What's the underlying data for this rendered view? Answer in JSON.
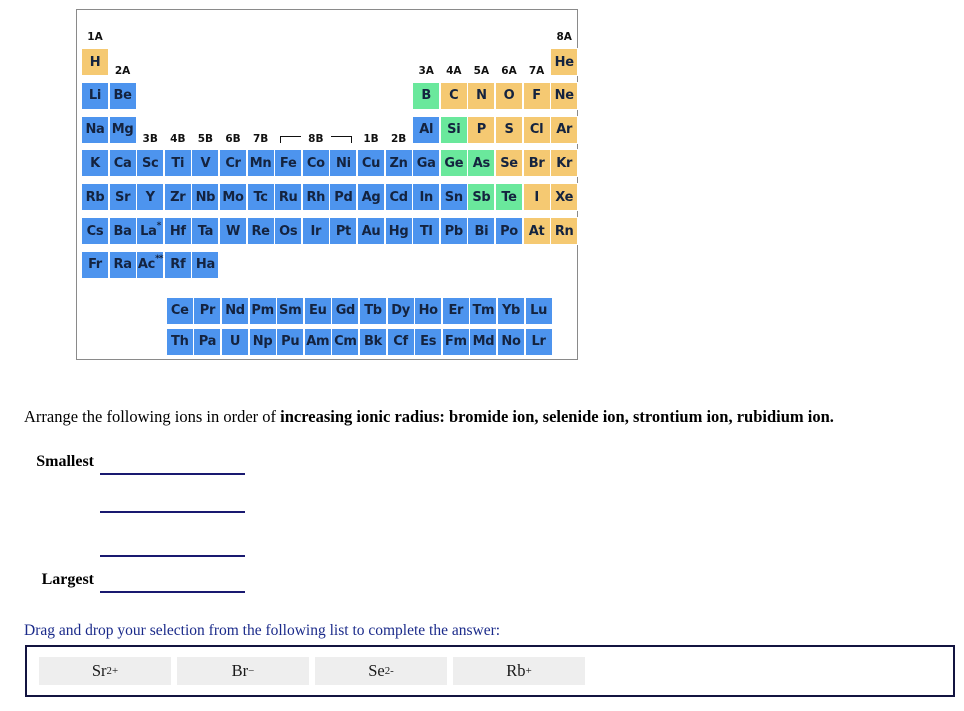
{
  "periodic_table": {
    "colors": {
      "metal": "#4d94ee",
      "metalloid": "#6ae89c",
      "nonmetal": "#f5c972",
      "border": "#8a8a8a",
      "symbol_text": "#14233f"
    },
    "group_labels": [
      {
        "label": "1A",
        "col": 1,
        "row": 0
      },
      {
        "label": "2A",
        "col": 2,
        "row": 1
      },
      {
        "label": "3B",
        "col": 3,
        "row": 3
      },
      {
        "label": "4B",
        "col": 4,
        "row": 3
      },
      {
        "label": "5B",
        "col": 5,
        "row": 3
      },
      {
        "label": "6B",
        "col": 6,
        "row": 3
      },
      {
        "label": "7B",
        "col": 7,
        "row": 3
      },
      {
        "label": "8B",
        "col": 9,
        "row": 3
      },
      {
        "label": "1B",
        "col": 11,
        "row": 3
      },
      {
        "label": "2B",
        "col": 12,
        "row": 3
      },
      {
        "label": "3A",
        "col": 13,
        "row": 1
      },
      {
        "label": "4A",
        "col": 14,
        "row": 1
      },
      {
        "label": "5A",
        "col": 15,
        "row": 1
      },
      {
        "label": "6A",
        "col": 16,
        "row": 1
      },
      {
        "label": "7A",
        "col": 17,
        "row": 1
      },
      {
        "label": "8A",
        "col": 18,
        "row": 0
      }
    ],
    "elements": [
      {
        "sym": "H",
        "col": 1,
        "row": 1,
        "cat": "nonmetal"
      },
      {
        "sym": "He",
        "col": 18,
        "row": 1,
        "cat": "nonmetal"
      },
      {
        "sym": "Li",
        "col": 1,
        "row": 2,
        "cat": "metal"
      },
      {
        "sym": "Be",
        "col": 2,
        "row": 2,
        "cat": "metal"
      },
      {
        "sym": "B",
        "col": 13,
        "row": 2,
        "cat": "metalloid"
      },
      {
        "sym": "C",
        "col": 14,
        "row": 2,
        "cat": "nonmetal"
      },
      {
        "sym": "N",
        "col": 15,
        "row": 2,
        "cat": "nonmetal"
      },
      {
        "sym": "O",
        "col": 16,
        "row": 2,
        "cat": "nonmetal"
      },
      {
        "sym": "F",
        "col": 17,
        "row": 2,
        "cat": "nonmetal"
      },
      {
        "sym": "Ne",
        "col": 18,
        "row": 2,
        "cat": "nonmetal"
      },
      {
        "sym": "Na",
        "col": 1,
        "row": 3,
        "cat": "metal"
      },
      {
        "sym": "Mg",
        "col": 2,
        "row": 3,
        "cat": "metal"
      },
      {
        "sym": "Al",
        "col": 13,
        "row": 3,
        "cat": "metal"
      },
      {
        "sym": "Si",
        "col": 14,
        "row": 3,
        "cat": "metalloid"
      },
      {
        "sym": "P",
        "col": 15,
        "row": 3,
        "cat": "nonmetal"
      },
      {
        "sym": "S",
        "col": 16,
        "row": 3,
        "cat": "nonmetal"
      },
      {
        "sym": "Cl",
        "col": 17,
        "row": 3,
        "cat": "nonmetal"
      },
      {
        "sym": "Ar",
        "col": 18,
        "row": 3,
        "cat": "nonmetal"
      },
      {
        "sym": "K",
        "col": 1,
        "row": 4,
        "cat": "metal"
      },
      {
        "sym": "Ca",
        "col": 2,
        "row": 4,
        "cat": "metal"
      },
      {
        "sym": "Sc",
        "col": 3,
        "row": 4,
        "cat": "metal"
      },
      {
        "sym": "Ti",
        "col": 4,
        "row": 4,
        "cat": "metal"
      },
      {
        "sym": "V",
        "col": 5,
        "row": 4,
        "cat": "metal"
      },
      {
        "sym": "Cr",
        "col": 6,
        "row": 4,
        "cat": "metal"
      },
      {
        "sym": "Mn",
        "col": 7,
        "row": 4,
        "cat": "metal"
      },
      {
        "sym": "Fe",
        "col": 8,
        "row": 4,
        "cat": "metal"
      },
      {
        "sym": "Co",
        "col": 9,
        "row": 4,
        "cat": "metal"
      },
      {
        "sym": "Ni",
        "col": 10,
        "row": 4,
        "cat": "metal"
      },
      {
        "sym": "Cu",
        "col": 11,
        "row": 4,
        "cat": "metal"
      },
      {
        "sym": "Zn",
        "col": 12,
        "row": 4,
        "cat": "metal"
      },
      {
        "sym": "Ga",
        "col": 13,
        "row": 4,
        "cat": "metal"
      },
      {
        "sym": "Ge",
        "col": 14,
        "row": 4,
        "cat": "metalloid"
      },
      {
        "sym": "As",
        "col": 15,
        "row": 4,
        "cat": "metalloid"
      },
      {
        "sym": "Se",
        "col": 16,
        "row": 4,
        "cat": "nonmetal"
      },
      {
        "sym": "Br",
        "col": 17,
        "row": 4,
        "cat": "nonmetal"
      },
      {
        "sym": "Kr",
        "col": 18,
        "row": 4,
        "cat": "nonmetal"
      },
      {
        "sym": "Rb",
        "col": 1,
        "row": 5,
        "cat": "metal"
      },
      {
        "sym": "Sr",
        "col": 2,
        "row": 5,
        "cat": "metal"
      },
      {
        "sym": "Y",
        "col": 3,
        "row": 5,
        "cat": "metal"
      },
      {
        "sym": "Zr",
        "col": 4,
        "row": 5,
        "cat": "metal"
      },
      {
        "sym": "Nb",
        "col": 5,
        "row": 5,
        "cat": "metal"
      },
      {
        "sym": "Mo",
        "col": 6,
        "row": 5,
        "cat": "metal"
      },
      {
        "sym": "Tc",
        "col": 7,
        "row": 5,
        "cat": "metal"
      },
      {
        "sym": "Ru",
        "col": 8,
        "row": 5,
        "cat": "metal"
      },
      {
        "sym": "Rh",
        "col": 9,
        "row": 5,
        "cat": "metal"
      },
      {
        "sym": "Pd",
        "col": 10,
        "row": 5,
        "cat": "metal"
      },
      {
        "sym": "Ag",
        "col": 11,
        "row": 5,
        "cat": "metal"
      },
      {
        "sym": "Cd",
        "col": 12,
        "row": 5,
        "cat": "metal"
      },
      {
        "sym": "In",
        "col": 13,
        "row": 5,
        "cat": "metal"
      },
      {
        "sym": "Sn",
        "col": 14,
        "row": 5,
        "cat": "metal"
      },
      {
        "sym": "Sb",
        "col": 15,
        "row": 5,
        "cat": "metalloid"
      },
      {
        "sym": "Te",
        "col": 16,
        "row": 5,
        "cat": "metalloid"
      },
      {
        "sym": "I",
        "col": 17,
        "row": 5,
        "cat": "nonmetal"
      },
      {
        "sym": "Xe",
        "col": 18,
        "row": 5,
        "cat": "nonmetal"
      },
      {
        "sym": "Cs",
        "col": 1,
        "row": 6,
        "cat": "metal"
      },
      {
        "sym": "Ba",
        "col": 2,
        "row": 6,
        "cat": "metal"
      },
      {
        "sym": "La",
        "col": 3,
        "row": 6,
        "cat": "metal",
        "mark": "*"
      },
      {
        "sym": "Hf",
        "col": 4,
        "row": 6,
        "cat": "metal"
      },
      {
        "sym": "Ta",
        "col": 5,
        "row": 6,
        "cat": "metal"
      },
      {
        "sym": "W",
        "col": 6,
        "row": 6,
        "cat": "metal"
      },
      {
        "sym": "Re",
        "col": 7,
        "row": 6,
        "cat": "metal"
      },
      {
        "sym": "Os",
        "col": 8,
        "row": 6,
        "cat": "metal"
      },
      {
        "sym": "Ir",
        "col": 9,
        "row": 6,
        "cat": "metal"
      },
      {
        "sym": "Pt",
        "col": 10,
        "row": 6,
        "cat": "metal"
      },
      {
        "sym": "Au",
        "col": 11,
        "row": 6,
        "cat": "metal"
      },
      {
        "sym": "Hg",
        "col": 12,
        "row": 6,
        "cat": "metal"
      },
      {
        "sym": "Tl",
        "col": 13,
        "row": 6,
        "cat": "metal"
      },
      {
        "sym": "Pb",
        "col": 14,
        "row": 6,
        "cat": "metal"
      },
      {
        "sym": "Bi",
        "col": 15,
        "row": 6,
        "cat": "metal"
      },
      {
        "sym": "Po",
        "col": 16,
        "row": 6,
        "cat": "metal"
      },
      {
        "sym": "At",
        "col": 17,
        "row": 6,
        "cat": "nonmetal"
      },
      {
        "sym": "Rn",
        "col": 18,
        "row": 6,
        "cat": "nonmetal"
      },
      {
        "sym": "Fr",
        "col": 1,
        "row": 7,
        "cat": "metal"
      },
      {
        "sym": "Ra",
        "col": 2,
        "row": 7,
        "cat": "metal"
      },
      {
        "sym": "Ac",
        "col": 3,
        "row": 7,
        "cat": "metal",
        "mark": "**"
      },
      {
        "sym": "Rf",
        "col": 4,
        "row": 7,
        "cat": "metal"
      },
      {
        "sym": "Ha",
        "col": 5,
        "row": 7,
        "cat": "metal"
      }
    ],
    "lanthanides": [
      "Ce",
      "Pr",
      "Nd",
      "Pm",
      "Sm",
      "Eu",
      "Gd",
      "Tb",
      "Dy",
      "Ho",
      "Er",
      "Tm",
      "Yb",
      "Lu"
    ],
    "actinides": [
      "Th",
      "Pa",
      "U",
      "Np",
      "Pu",
      "Am",
      "Cm",
      "Bk",
      "Cf",
      "Es",
      "Fm",
      "Md",
      "No",
      "Lr"
    ]
  },
  "question": {
    "prefix": "Arrange the following ions in order of ",
    "emphasis": "increasing ionic radius: bromide ion, selenide ion, strontium ion, rubidium ion."
  },
  "answer": {
    "smallest_label": "Smallest",
    "largest_label": "Largest",
    "blanks": [
      {
        "value": ""
      },
      {
        "value": ""
      },
      {
        "value": ""
      },
      {
        "value": ""
      }
    ]
  },
  "drag_drop": {
    "instruction": "Drag and drop your selection from the following list to complete the answer:",
    "border_color": "#131440",
    "chips": [
      {
        "base": "Sr",
        "charge": "2+"
      },
      {
        "base": "Br",
        "charge": "−"
      },
      {
        "base": "Se",
        "charge": "2-"
      },
      {
        "base": "Rb",
        "charge": "+"
      }
    ]
  }
}
